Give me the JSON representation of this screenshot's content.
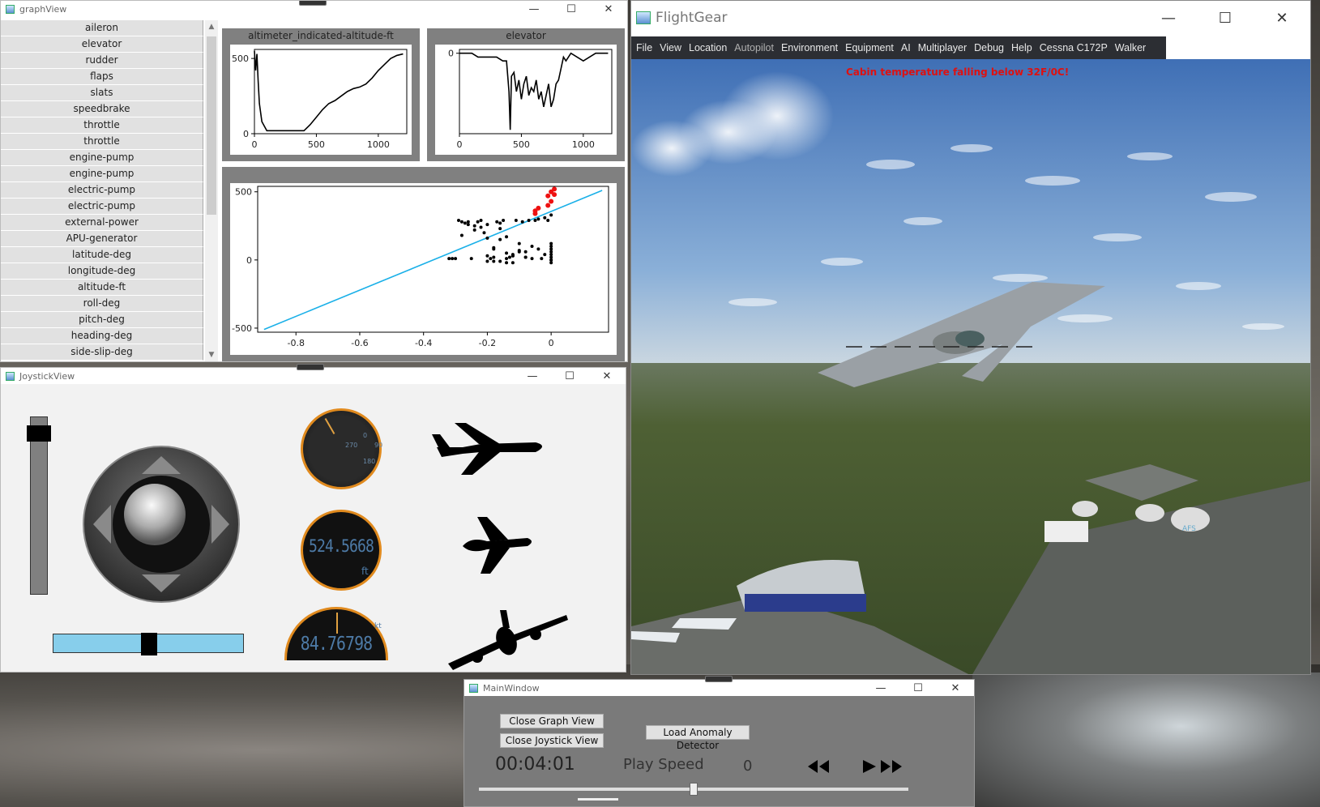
{
  "graph_view": {
    "title": "graphView",
    "params": [
      "aileron",
      "elevator",
      "rudder",
      "flaps",
      "slats",
      "speedbrake",
      "throttle",
      "throttle",
      "engine-pump",
      "engine-pump",
      "electric-pump",
      "electric-pump",
      "external-power",
      "APU-generator",
      "latitude-deg",
      "longitude-deg",
      "altitude-ft",
      "roll-deg",
      "pitch-deg",
      "heading-deg",
      "side-slip-deg"
    ],
    "plot1": {
      "title": "altimeter_indicated-altitude-ft",
      "y_ticks": [
        "500",
        "0"
      ],
      "x_ticks": [
        "0",
        "500",
        "1000"
      ]
    },
    "plot2": {
      "title": "elevator",
      "y_ticks": [
        "0"
      ],
      "x_ticks": [
        "0",
        "500",
        "1000"
      ]
    },
    "plot3": {
      "title": "",
      "y_ticks": [
        "500",
        "0",
        "-500"
      ],
      "x_ticks": [
        "-0.8",
        "-0.6",
        "-0.4",
        "-0.2",
        "0"
      ]
    }
  },
  "joystick_view": {
    "title": "JoystickView",
    "heading_ticks": [
      "0",
      "270",
      "90",
      "180"
    ],
    "altitude_value": "524.5668",
    "altitude_unit": "ft",
    "speed_value": "84.76798",
    "speed_unit": "kt",
    "throttle_level": 0.05,
    "rudder_level": 0.5
  },
  "main_window": {
    "title": "MainWindow",
    "close_graph_label": "Close Graph View",
    "close_joystick_label": "Close Joystick View",
    "load_detector_label": "Load Anomaly Detector",
    "time": "00:04:01",
    "play_speed_label": "Play Speed",
    "play_speed_value": "0",
    "playback_position": 0.5
  },
  "flightgear": {
    "title": "FlightGear",
    "menu": [
      "File",
      "View",
      "Location",
      "Autopilot",
      "Environment",
      "Equipment",
      "AI",
      "Multiplayer",
      "Debug",
      "Help",
      "Cessna C172P",
      "Walker"
    ],
    "warning": "Cabin temperature falling below 32F/0C!",
    "tank_label": "AFS"
  },
  "window_controls": {
    "minimize": "—",
    "maximize": "☐",
    "close": "✕"
  },
  "chart_data": [
    {
      "type": "line",
      "title": "altimeter_indicated-altitude-ft",
      "x": [
        0,
        10,
        20,
        30,
        40,
        60,
        100,
        200,
        300,
        400,
        450,
        500,
        550,
        600,
        650,
        700,
        750,
        800,
        850,
        900,
        950,
        1000,
        1050,
        1100,
        1150,
        1200
      ],
      "values": [
        550,
        420,
        530,
        350,
        200,
        80,
        20,
        20,
        20,
        20,
        60,
        110,
        160,
        200,
        220,
        250,
        280,
        300,
        310,
        330,
        370,
        420,
        460,
        500,
        520,
        530
      ],
      "xlim": [
        0,
        1230
      ],
      "ylim": [
        0,
        560
      ]
    },
    {
      "type": "line",
      "title": "elevator",
      "x": [
        0,
        100,
        150,
        300,
        350,
        380,
        390,
        400,
        410,
        420,
        440,
        460,
        480,
        500,
        520,
        540,
        560,
        580,
        600,
        620,
        640,
        660,
        680,
        700,
        720,
        740,
        760,
        780,
        800,
        820,
        840,
        860,
        900,
        950,
        1000,
        1100,
        1200
      ],
      "values": [
        0,
        0,
        -0.05,
        -0.05,
        -0.1,
        -0.1,
        -0.3,
        -0.5,
        -1.0,
        -0.3,
        -0.25,
        -0.5,
        -0.35,
        -0.6,
        -0.4,
        -0.3,
        -0.55,
        -0.45,
        -0.5,
        -0.35,
        -0.6,
        -0.5,
        -0.7,
        -0.55,
        -0.4,
        -0.7,
        -0.6,
        -0.4,
        -0.35,
        -0.2,
        -0.05,
        -0.1,
        0,
        -0.05,
        -0.1,
        0,
        0
      ],
      "xlim": [
        0,
        1230
      ],
      "ylim": [
        -1.05,
        0.05
      ]
    },
    {
      "type": "scatter",
      "x": [
        -0.32,
        -0.31,
        -0.3,
        -0.29,
        -0.28,
        -0.27,
        -0.26,
        -0.25,
        -0.24,
        -0.23,
        -0.22,
        -0.21,
        -0.2,
        -0.19,
        -0.18,
        -0.17,
        -0.16,
        -0.15,
        -0.14,
        -0.13,
        -0.12,
        -0.11,
        -0.1,
        -0.09,
        -0.08,
        -0.07,
        -0.06,
        -0.05,
        -0.04,
        -0.03,
        -0.02,
        -0.01,
        0,
        -0.28,
        -0.26,
        -0.24,
        -0.22,
        -0.2,
        -0.18,
        -0.16,
        -0.14,
        -0.12,
        -0.1,
        -0.08,
        -0.06,
        -0.04,
        -0.02,
        0,
        -0.2,
        -0.18,
        -0.16,
        -0.14,
        -0.12,
        -0.1,
        -0.08,
        -0.2,
        -0.18,
        -0.16,
        -0.14,
        -0.12,
        0,
        0,
        0,
        0,
        0,
        0,
        0,
        0
      ],
      "values": [
        10,
        10,
        10,
        290,
        280,
        270,
        260,
        10,
        250,
        280,
        290,
        200,
        260,
        10,
        80,
        280,
        230,
        290,
        10,
        20,
        30,
        290,
        60,
        280,
        20,
        290,
        10,
        290,
        300,
        10,
        310,
        290,
        330,
        180,
        280,
        220,
        240,
        160,
        90,
        150,
        170,
        30,
        120,
        60,
        100,
        80,
        40,
        0,
        30,
        20,
        270,
        50,
        40,
        70,
        20,
        -10,
        -10,
        -10,
        -20,
        -20,
        -20,
        0,
        20,
        40,
        60,
        80,
        100,
        120
      ],
      "anomaly_x": [
        -0.05,
        -0.05,
        -0.04,
        -0.01,
        0,
        0.01,
        0,
        0.01,
        -0.01
      ],
      "anomaly_y": [
        360,
        340,
        380,
        400,
        430,
        480,
        500,
        520,
        470
      ],
      "line_x": [
        -0.9,
        0.16
      ],
      "line_y": [
        -510,
        510
      ],
      "xlim": [
        -0.92,
        0.18
      ],
      "ylim": [
        -530,
        540
      ]
    }
  ]
}
